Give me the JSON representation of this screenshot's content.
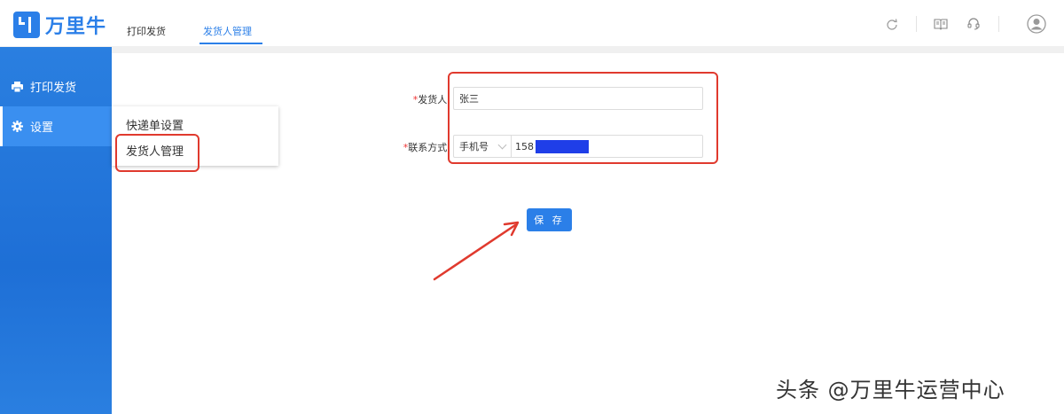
{
  "app": {
    "logo_text": "万里牛"
  },
  "nav": {
    "items": [
      {
        "label": "打印发货"
      },
      {
        "label": "发货人管理"
      }
    ]
  },
  "header_icons": [
    "refresh-icon",
    "book-icon",
    "headset-icon",
    "user-avatar-icon"
  ],
  "sidebar": {
    "items": [
      {
        "label": "打印发货",
        "icon": "printer-icon"
      },
      {
        "label": "设置",
        "icon": "gear-icon"
      }
    ]
  },
  "submenu": {
    "items": [
      {
        "label": "快递单设置"
      },
      {
        "label": "发货人管理"
      }
    ]
  },
  "form": {
    "sender": {
      "required_mark": "*",
      "label": "发货人:",
      "value": "张三"
    },
    "contact": {
      "required_mark": "*",
      "label": "联系方式:",
      "type_value": "手机号",
      "phone_value": "158"
    },
    "save_label": "保 存"
  },
  "watermark": "头条 @万里牛运营中心",
  "colors": {
    "brand": "#2b7fe8",
    "annotation": "#e03a2e",
    "redaction": "#1f3ee8"
  }
}
